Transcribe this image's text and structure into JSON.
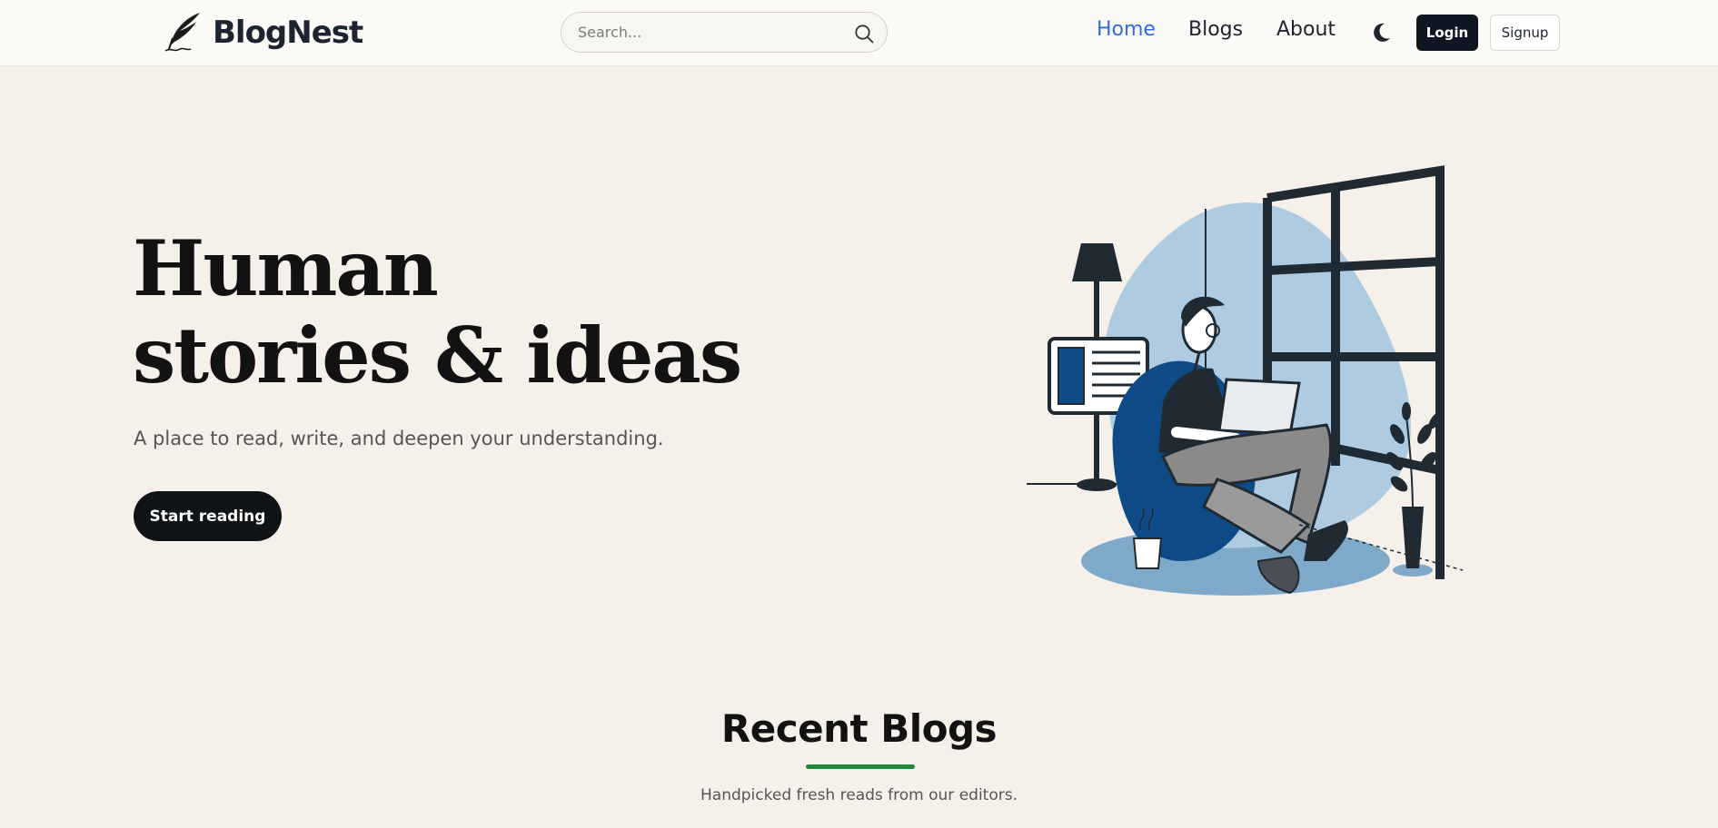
{
  "header": {
    "brand": "BlogNest",
    "search": {
      "placeholder": "Search...",
      "value": ""
    },
    "nav": [
      {
        "label": "Home",
        "active": true
      },
      {
        "label": "Blogs",
        "active": false
      },
      {
        "label": "About",
        "active": false
      }
    ],
    "theme_toggle_icon": "moon-icon",
    "login_label": "Login",
    "signup_label": "Signup"
  },
  "hero": {
    "title_line1": "Human",
    "title_line2": "stories & ideas",
    "subtitle": "A place to read, write, and deepen your understanding.",
    "cta_label": "Start reading",
    "illustration": "man-reading-laptop-in-beanbag-illustration"
  },
  "recent": {
    "title": "Recent Blogs",
    "subtitle": "Handpicked fresh reads from our editors.",
    "underline_color": "#1f8a3b"
  },
  "colors": {
    "accent": "#2f6de0",
    "background": "#f5f0e9",
    "dark": "#111417",
    "illustration_blue": "#0e4a86"
  }
}
